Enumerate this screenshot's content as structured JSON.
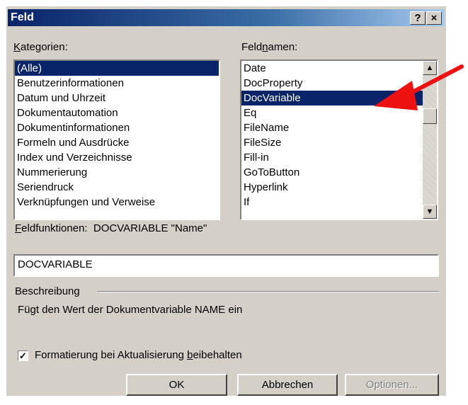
{
  "window": {
    "title": "Feld",
    "help_label": "?",
    "close_label": "×"
  },
  "categories": {
    "label": "Kategorien:",
    "items": [
      "(Alle)",
      "Benutzerinformationen",
      "Datum und Uhrzeit",
      "Dokumentautomation",
      "Dokumentinformationen",
      "Formeln und Ausdrücke",
      "Index und Verzeichnisse",
      "Nummerierung",
      "Seriendruck",
      "Verknüpfungen und Verweise"
    ],
    "selected": "(Alle)"
  },
  "fieldnames": {
    "label": "Feldnamen:",
    "items": [
      "Date",
      "DocProperty",
      "DocVariable",
      "Eq",
      "FileName",
      "FileSize",
      "Fill-in",
      "GoToButton",
      "Hyperlink",
      "If"
    ],
    "selected": "DocVariable"
  },
  "field_codes": {
    "label": "Feldfunktionen:",
    "syntax": "DOCVARIABLE \"Name\"",
    "input_value": "DOCVARIABLE"
  },
  "description": {
    "label": "Beschreibung",
    "text": "Fügt den Wert der Dokumentvariable NAME ein"
  },
  "preserve_formatting": {
    "label": "Formatierung bei Aktualisierung beibehalten",
    "checked": true
  },
  "buttons": {
    "ok": "OK",
    "cancel": "Abbrechen",
    "options": "Optionen..."
  },
  "annotation": {
    "color": "#ee1111"
  }
}
